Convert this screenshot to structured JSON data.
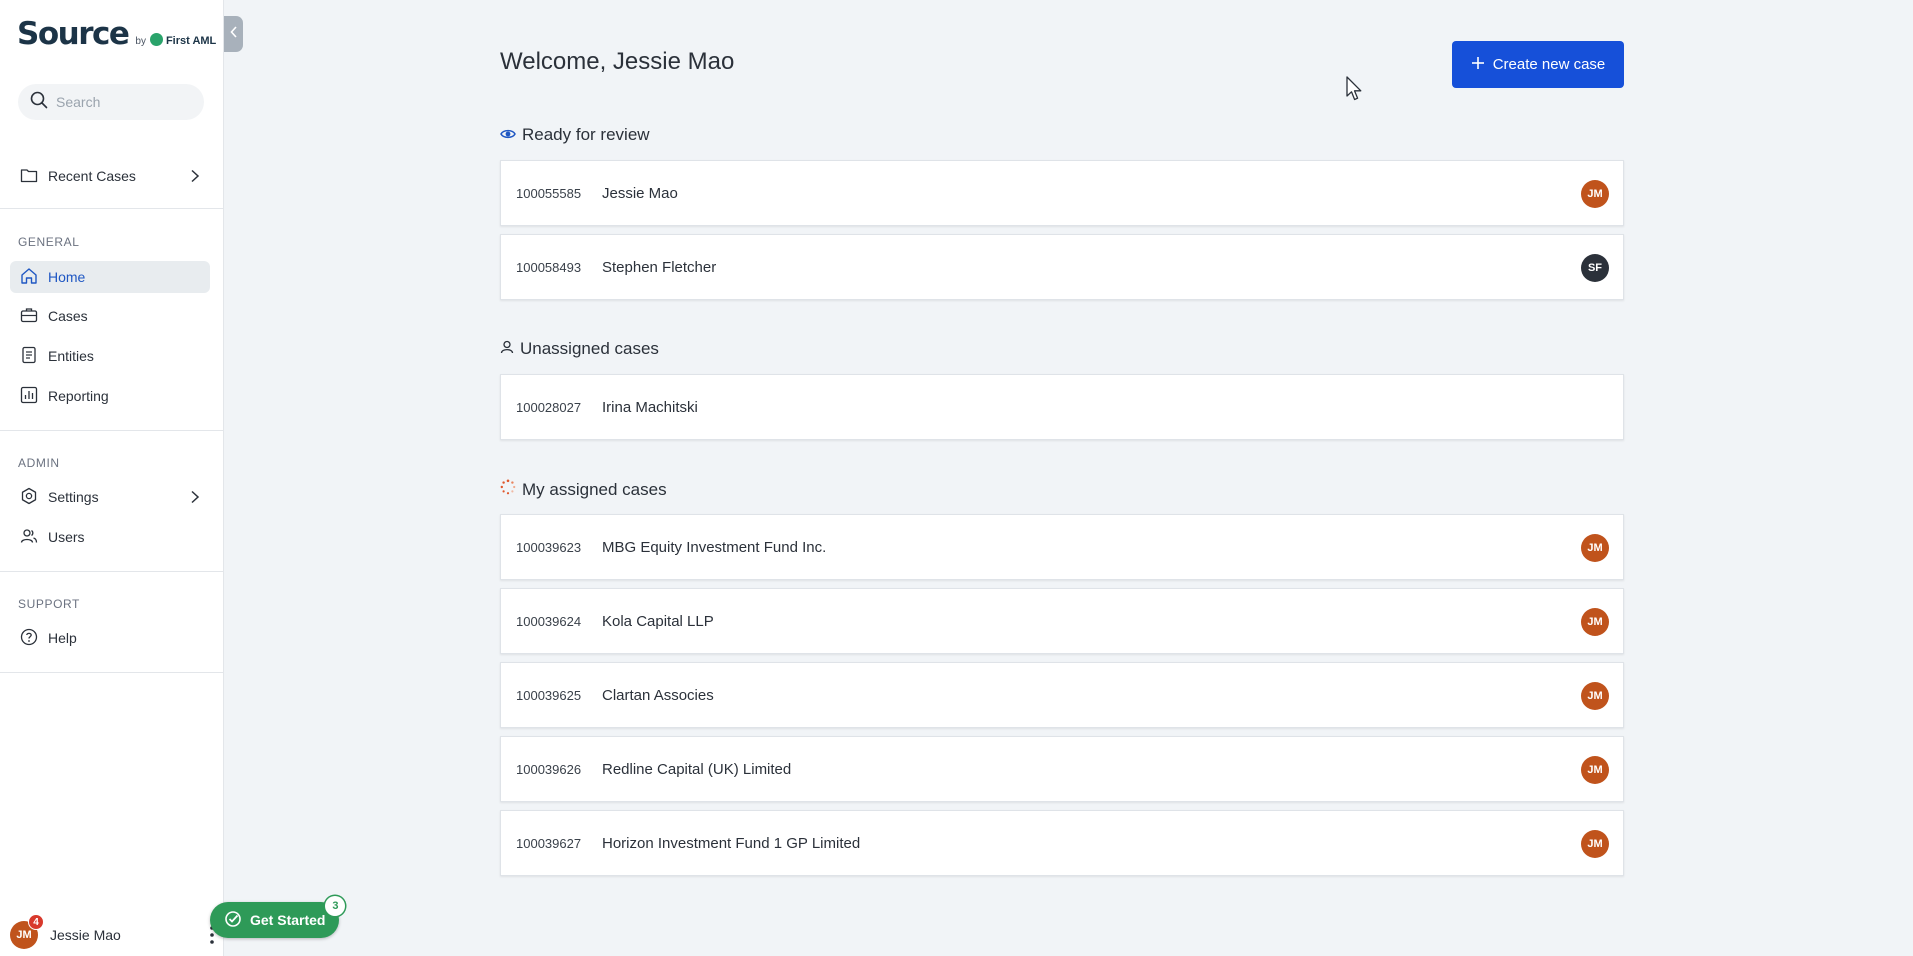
{
  "app": {
    "brand": "Source",
    "brand_by": "by",
    "brand_partner": "First AML"
  },
  "sidebar": {
    "search_placeholder": "Search",
    "recent_cases": "Recent Cases",
    "general_label": "GENERAL",
    "general_items": [
      {
        "label": "Home",
        "icon": "home-icon",
        "active": true
      },
      {
        "label": "Cases",
        "icon": "briefcase-icon",
        "active": false
      },
      {
        "label": "Entities",
        "icon": "document-icon",
        "active": false
      },
      {
        "label": "Reporting",
        "icon": "chart-icon",
        "active": false
      }
    ],
    "admin_label": "ADMIN",
    "admin_items": [
      {
        "label": "Settings",
        "icon": "gear-icon"
      },
      {
        "label": "Users",
        "icon": "users-icon"
      }
    ],
    "support_label": "SUPPORT",
    "support_items": [
      {
        "label": "Help",
        "icon": "help-icon"
      }
    ],
    "user": {
      "initials": "JM",
      "name": "Jessie Mao",
      "notifications": "4"
    }
  },
  "get_started": {
    "label": "Get Started",
    "count": "3"
  },
  "main": {
    "welcome": "Welcome, Jessie Mao",
    "create_button": "Create new case",
    "sections": [
      {
        "title": "Ready for review",
        "icon": "eye-icon",
        "cases": [
          {
            "id": "100055585",
            "name": "Jessie Mao",
            "assignee": "JM",
            "assignee_color": "#c0531c"
          },
          {
            "id": "100058493",
            "name": "Stephen Fletcher",
            "assignee": "SF",
            "assignee_color": "#2b313a"
          }
        ]
      },
      {
        "title": "Unassigned cases",
        "icon": "person-icon",
        "cases": [
          {
            "id": "100028027",
            "name": "Irina Machitski",
            "assignee": "",
            "assignee_color": ""
          }
        ]
      },
      {
        "title": "My assigned cases",
        "icon": "progress-spinner-icon",
        "cases": [
          {
            "id": "100039623",
            "name": "MBG Equity Investment Fund Inc.",
            "assignee": "JM",
            "assignee_color": "#c0531c"
          },
          {
            "id": "100039624",
            "name": "Kola Capital LLP",
            "assignee": "JM",
            "assignee_color": "#c0531c"
          },
          {
            "id": "100039625",
            "name": "Clartan Associes",
            "assignee": "JM",
            "assignee_color": "#c0531c"
          },
          {
            "id": "100039626",
            "name": "Redline Capital (UK) Limited",
            "assignee": "JM",
            "assignee_color": "#c0531c"
          },
          {
            "id": "100039627",
            "name": "Horizon Investment Fund 1 GP Limited",
            "assignee": "JM",
            "assignee_color": "#c0531c"
          }
        ]
      }
    ]
  },
  "colors": {
    "accent": "#1650d9",
    "active_nav": "#1f57c3",
    "avatar_orange": "#c0531c",
    "get_started_green": "#2e9a58"
  }
}
